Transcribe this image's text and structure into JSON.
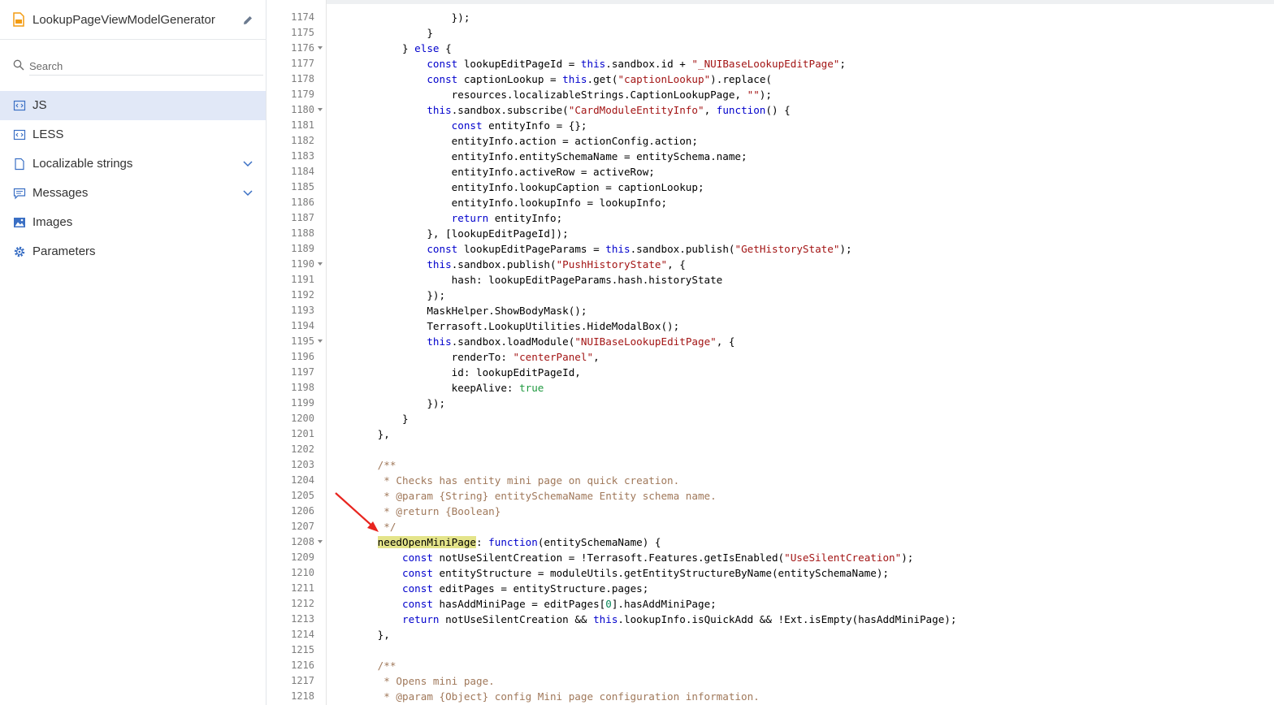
{
  "sidebar": {
    "title": "LookupPageViewModelGenerator",
    "search_placeholder": "Search",
    "items": [
      {
        "label": "JS",
        "icon": "code-file-icon"
      },
      {
        "label": "LESS",
        "icon": "code-file-icon"
      },
      {
        "label": "Localizable strings",
        "icon": "document-icon"
      },
      {
        "label": "Messages",
        "icon": "message-icon"
      },
      {
        "label": "Images",
        "icon": "image-icon"
      },
      {
        "label": "Parameters",
        "icon": "gear-icon"
      }
    ]
  },
  "colors": {
    "keyword": "#0000cc",
    "string": "#a31515",
    "comment": "#a0785a",
    "boolean": "#219a41",
    "highlight": "#e4e48a",
    "active_nav": "#e1e8f7",
    "arrow": "#e8251f"
  },
  "editor": {
    "fold_lines": [
      1176,
      1180,
      1190,
      1195,
      1208
    ],
    "lines": [
      {
        "n": 1174,
        "t": [
          [
            "",
            "        });"
          ]
        ]
      },
      {
        "n": 1175,
        "t": [
          [
            "",
            "    }"
          ]
        ]
      },
      {
        "n": 1176,
        "t": [
          [
            "",
            "} "
          ],
          [
            "kw",
            "else"
          ],
          [
            "",
            " {"
          ]
        ]
      },
      {
        "n": 1177,
        "t": [
          [
            "",
            "    "
          ],
          [
            "kw",
            "const"
          ],
          [
            "",
            " lookupEditPageId = "
          ],
          [
            "kw",
            "this"
          ],
          [
            "",
            ".sandbox.id + "
          ],
          [
            "str",
            "\"_NUIBaseLookupEditPage\""
          ],
          [
            "",
            ";"
          ]
        ]
      },
      {
        "n": 1178,
        "t": [
          [
            "",
            "    "
          ],
          [
            "kw",
            "const"
          ],
          [
            "",
            " captionLookup = "
          ],
          [
            "kw",
            "this"
          ],
          [
            "",
            ".get("
          ],
          [
            "str",
            "\"captionLookup\""
          ],
          [
            "",
            ").replace("
          ]
        ]
      },
      {
        "n": 1179,
        "t": [
          [
            "",
            "        resources.localizableStrings.CaptionLookupPage, "
          ],
          [
            "str",
            "\"\""
          ],
          [
            "",
            ");"
          ]
        ]
      },
      {
        "n": 1180,
        "t": [
          [
            "",
            "    "
          ],
          [
            "kw",
            "this"
          ],
          [
            "",
            ".sandbox.subscribe("
          ],
          [
            "str",
            "\"CardModuleEntityInfo\""
          ],
          [
            "",
            ", "
          ],
          [
            "kw",
            "function"
          ],
          [
            "",
            "() {"
          ]
        ]
      },
      {
        "n": 1181,
        "t": [
          [
            "",
            "        "
          ],
          [
            "kw",
            "const"
          ],
          [
            "",
            " entityInfo = {};"
          ]
        ]
      },
      {
        "n": 1182,
        "t": [
          [
            "",
            "        entityInfo.action = actionConfig.action;"
          ]
        ]
      },
      {
        "n": 1183,
        "t": [
          [
            "",
            "        entityInfo.entitySchemaName = entitySchema.name;"
          ]
        ]
      },
      {
        "n": 1184,
        "t": [
          [
            "",
            "        entityInfo.activeRow = activeRow;"
          ]
        ]
      },
      {
        "n": 1185,
        "t": [
          [
            "",
            "        entityInfo.lookupCaption = captionLookup;"
          ]
        ]
      },
      {
        "n": 1186,
        "t": [
          [
            "",
            "        entityInfo.lookupInfo = lookupInfo;"
          ]
        ]
      },
      {
        "n": 1187,
        "t": [
          [
            "",
            "        "
          ],
          [
            "kw",
            "return"
          ],
          [
            "",
            " entityInfo;"
          ]
        ]
      },
      {
        "n": 1188,
        "t": [
          [
            "",
            "    }, [lookupEditPageId]);"
          ]
        ]
      },
      {
        "n": 1189,
        "t": [
          [
            "",
            "    "
          ],
          [
            "kw",
            "const"
          ],
          [
            "",
            " lookupEditPageParams = "
          ],
          [
            "kw",
            "this"
          ],
          [
            "",
            ".sandbox.publish("
          ],
          [
            "str",
            "\"GetHistoryState\""
          ],
          [
            "",
            ");"
          ]
        ]
      },
      {
        "n": 1190,
        "t": [
          [
            "",
            "    "
          ],
          [
            "kw",
            "this"
          ],
          [
            "",
            ".sandbox.publish("
          ],
          [
            "str",
            "\"PushHistoryState\""
          ],
          [
            "",
            ", {"
          ]
        ]
      },
      {
        "n": 1191,
        "t": [
          [
            "",
            "        hash: lookupEditPageParams.hash.historyState"
          ]
        ]
      },
      {
        "n": 1192,
        "t": [
          [
            "",
            "    });"
          ]
        ]
      },
      {
        "n": 1193,
        "t": [
          [
            "",
            "    MaskHelper.ShowBodyMask();"
          ]
        ]
      },
      {
        "n": 1194,
        "t": [
          [
            "",
            "    Terrasoft.LookupUtilities.HideModalBox();"
          ]
        ]
      },
      {
        "n": 1195,
        "t": [
          [
            "",
            "    "
          ],
          [
            "kw",
            "this"
          ],
          [
            "",
            ".sandbox.loadModule("
          ],
          [
            "str",
            "\"NUIBaseLookupEditPage\""
          ],
          [
            "",
            ", {"
          ]
        ]
      },
      {
        "n": 1196,
        "t": [
          [
            "",
            "        renderTo: "
          ],
          [
            "str",
            "\"centerPanel\""
          ],
          [
            "",
            ","
          ]
        ]
      },
      {
        "n": 1197,
        "t": [
          [
            "",
            "        id: lookupEditPageId,"
          ]
        ]
      },
      {
        "n": 1198,
        "t": [
          [
            "",
            "        keepAlive: "
          ],
          [
            "bool",
            "true"
          ]
        ]
      },
      {
        "n": 1199,
        "t": [
          [
            "",
            "    });"
          ]
        ]
      },
      {
        "n": 1200,
        "t": [
          [
            "",
            "}"
          ]
        ]
      },
      {
        "n": 1201,
        "t": [
          [
            "",
            "},"
          ],
          [
            "",
            ""
          ]
        ],
        "indent": -1
      },
      {
        "n": 1202,
        "t": [
          [
            "",
            ""
          ]
        ]
      },
      {
        "n": 1203,
        "t": [
          [
            "cm",
            "/**"
          ]
        ],
        "indent": -1
      },
      {
        "n": 1204,
        "t": [
          [
            "cm",
            " * Checks has entity mini page on quick creation."
          ]
        ],
        "indent": -1
      },
      {
        "n": 1205,
        "t": [
          [
            "cm",
            " * @param {String} entitySchemaName Entity schema name."
          ]
        ],
        "indent": -1
      },
      {
        "n": 1206,
        "t": [
          [
            "cm",
            " * @return {Boolean}"
          ]
        ],
        "indent": -1
      },
      {
        "n": 1207,
        "t": [
          [
            "cm",
            " */"
          ]
        ],
        "indent": -1
      },
      {
        "n": 1208,
        "t": [
          [
            "hl",
            "needOpenMiniPage"
          ],
          [
            "",
            ": "
          ],
          [
            "kw",
            "function"
          ],
          [
            "",
            "(entitySchemaName) {"
          ]
        ],
        "indent": -1
      },
      {
        "n": 1209,
        "t": [
          [
            "",
            "    "
          ],
          [
            "kw",
            "const"
          ],
          [
            "",
            " notUseSilentCreation = !Terrasoft.Features.getIsEnabled("
          ],
          [
            "str",
            "\"UseSilentCreation\""
          ],
          [
            "",
            ");"
          ]
        ],
        "indent": -1
      },
      {
        "n": 1210,
        "t": [
          [
            "",
            "    "
          ],
          [
            "kw",
            "const"
          ],
          [
            "",
            " entityStructure = moduleUtils.getEntityStructureByName(entitySchemaName);"
          ]
        ],
        "indent": -1
      },
      {
        "n": 1211,
        "t": [
          [
            "",
            "    "
          ],
          [
            "kw",
            "const"
          ],
          [
            "",
            " editPages = entityStructure.pages;"
          ]
        ],
        "indent": -1
      },
      {
        "n": 1212,
        "t": [
          [
            "",
            "    "
          ],
          [
            "kw",
            "const"
          ],
          [
            "",
            " hasAddMiniPage = editPages["
          ],
          [
            "num",
            "0"
          ],
          [
            "",
            "].hasAddMiniPage;"
          ]
        ],
        "indent": -1
      },
      {
        "n": 1213,
        "t": [
          [
            "",
            "    "
          ],
          [
            "kw",
            "return"
          ],
          [
            "",
            " notUseSilentCreation && "
          ],
          [
            "kw",
            "this"
          ],
          [
            "",
            ".lookupInfo.isQuickAdd && !Ext.isEmpty(hasAddMiniPage);"
          ]
        ],
        "indent": -1
      },
      {
        "n": 1214,
        "t": [
          [
            "",
            "},"
          ]
        ],
        "indent": -1
      },
      {
        "n": 1215,
        "t": [
          [
            "",
            ""
          ]
        ]
      },
      {
        "n": 1216,
        "t": [
          [
            "cm",
            "/**"
          ]
        ],
        "indent": -1
      },
      {
        "n": 1217,
        "t": [
          [
            "cm",
            " * Opens mini page."
          ]
        ],
        "indent": -1
      },
      {
        "n": 1218,
        "t": [
          [
            "cm",
            " * @param {Object} config Mini page configuration information."
          ]
        ],
        "indent": -1
      }
    ]
  }
}
